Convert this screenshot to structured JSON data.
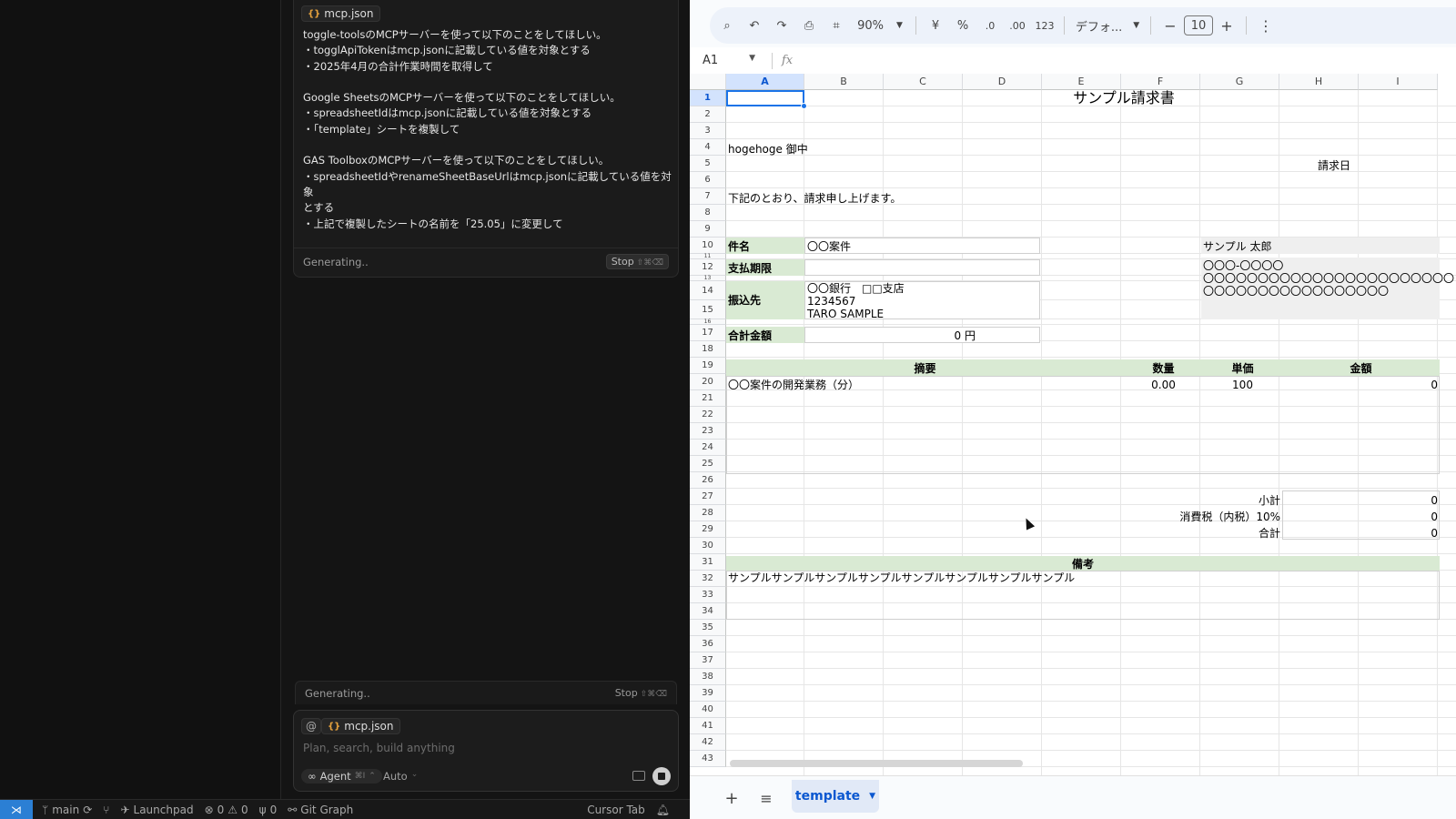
{
  "chat": {
    "file_chip": "mcp.json",
    "message_lines": [
      "toggle-toolsのMCPサーバーを使って以下のことをしてほしい。",
      "・togglApiTokenはmcp.jsonに記載している値を対象とする",
      "・2025年4月の合計作業時間を取得して",
      "",
      "Google SheetsのMCPサーバーを使って以下のことをしてほしい。",
      "・spreadsheetIdはmcp.jsonに記載している値を対象とする",
      "・「template」シートを複製して",
      "",
      "GAS ToolboxのMCPサーバーを使って以下のことをしてほしい。",
      "・spreadsheetIdやrenameSheetBaseUrlはmcp.jsonに記載している値を対象",
      "とする",
      "・上記で複製したシートの名前を「25.05」に変更して"
    ],
    "generating": "Generating..",
    "stop": "Stop",
    "stop_keys": "⇧⌘⌫"
  },
  "composer": {
    "at": "@",
    "file_chip": "mcp.json",
    "placeholder": "Plan, search, build anything",
    "agent": "Agent",
    "agent_keys": "⌘I",
    "mode": "Auto"
  },
  "statusbar": {
    "branch": "main",
    "launchpad": "Launchpad",
    "errors": "0",
    "warnings": "0",
    "ports": "0",
    "git_graph": "Git Graph",
    "cursor_tab": "Cursor Tab"
  },
  "toolbar": {
    "zoom": "90%",
    "currency": "¥",
    "percent": "%",
    "dec_decrease": ".0",
    "dec_increase": ".00",
    "number_format": "123",
    "font": "デフォ...",
    "font_size": "10"
  },
  "formula": {
    "cell_ref": "A1",
    "fx": "fx"
  },
  "columns": [
    "A",
    "B",
    "C",
    "D",
    "E",
    "F",
    "G",
    "H",
    "I"
  ],
  "rows": [
    "1",
    "2",
    "3",
    "4",
    "5",
    "6",
    "7",
    "8",
    "9",
    "10",
    "11",
    "12",
    "13",
    "14",
    "15",
    "16",
    "17",
    "18",
    "19",
    "20",
    "21",
    "22",
    "23",
    "24",
    "25",
    "26",
    "27",
    "28",
    "29",
    "30",
    "31",
    "32",
    "33",
    "34",
    "35",
    "36",
    "37",
    "38",
    "39",
    "40",
    "41",
    "42",
    "43"
  ],
  "invoice": {
    "title": "サンプル請求書",
    "client": "hogehoge 御中",
    "invoice_date_label": "請求日",
    "intro": "下記のとおり、請求申し上げます。",
    "subject_label": "件名",
    "subject_value": "〇〇案件",
    "due_label": "支払期限",
    "bank_label": "振込先",
    "bank_line1": "〇〇銀行　□□支店",
    "bank_line2": "1234567",
    "bank_line3": "TARO SAMPLE",
    "total_label": "合計金額",
    "total_value": "0 円",
    "issuer_name": "サンプル 太郎",
    "issuer_addr1": "〇〇〇-〇〇〇〇",
    "issuer_addr2": "〇〇〇〇〇〇〇〇〇〇〇〇〇〇〇〇〇〇〇〇〇〇〇",
    "issuer_addr3": "〇〇〇〇〇〇〇〇〇〇〇〇〇〇〇〇〇",
    "col_desc": "摘要",
    "col_qty": "数量",
    "col_unit": "単価",
    "col_amount": "金額",
    "item_desc": "〇〇案件の開発業務（分）",
    "item_qty": "0.00",
    "item_unit": "100",
    "item_amount": "0",
    "subtotal_label": "小計",
    "subtotal_value": "0",
    "tax_label": "消費税（内税）10%",
    "tax_value": "0",
    "grand_label": "合計",
    "grand_value": "0",
    "notes_label": "備考",
    "notes_value": "サンプルサンプルサンプルサンプルサンプルサンプルサンプルサンプル"
  },
  "sheet_tab": "template"
}
